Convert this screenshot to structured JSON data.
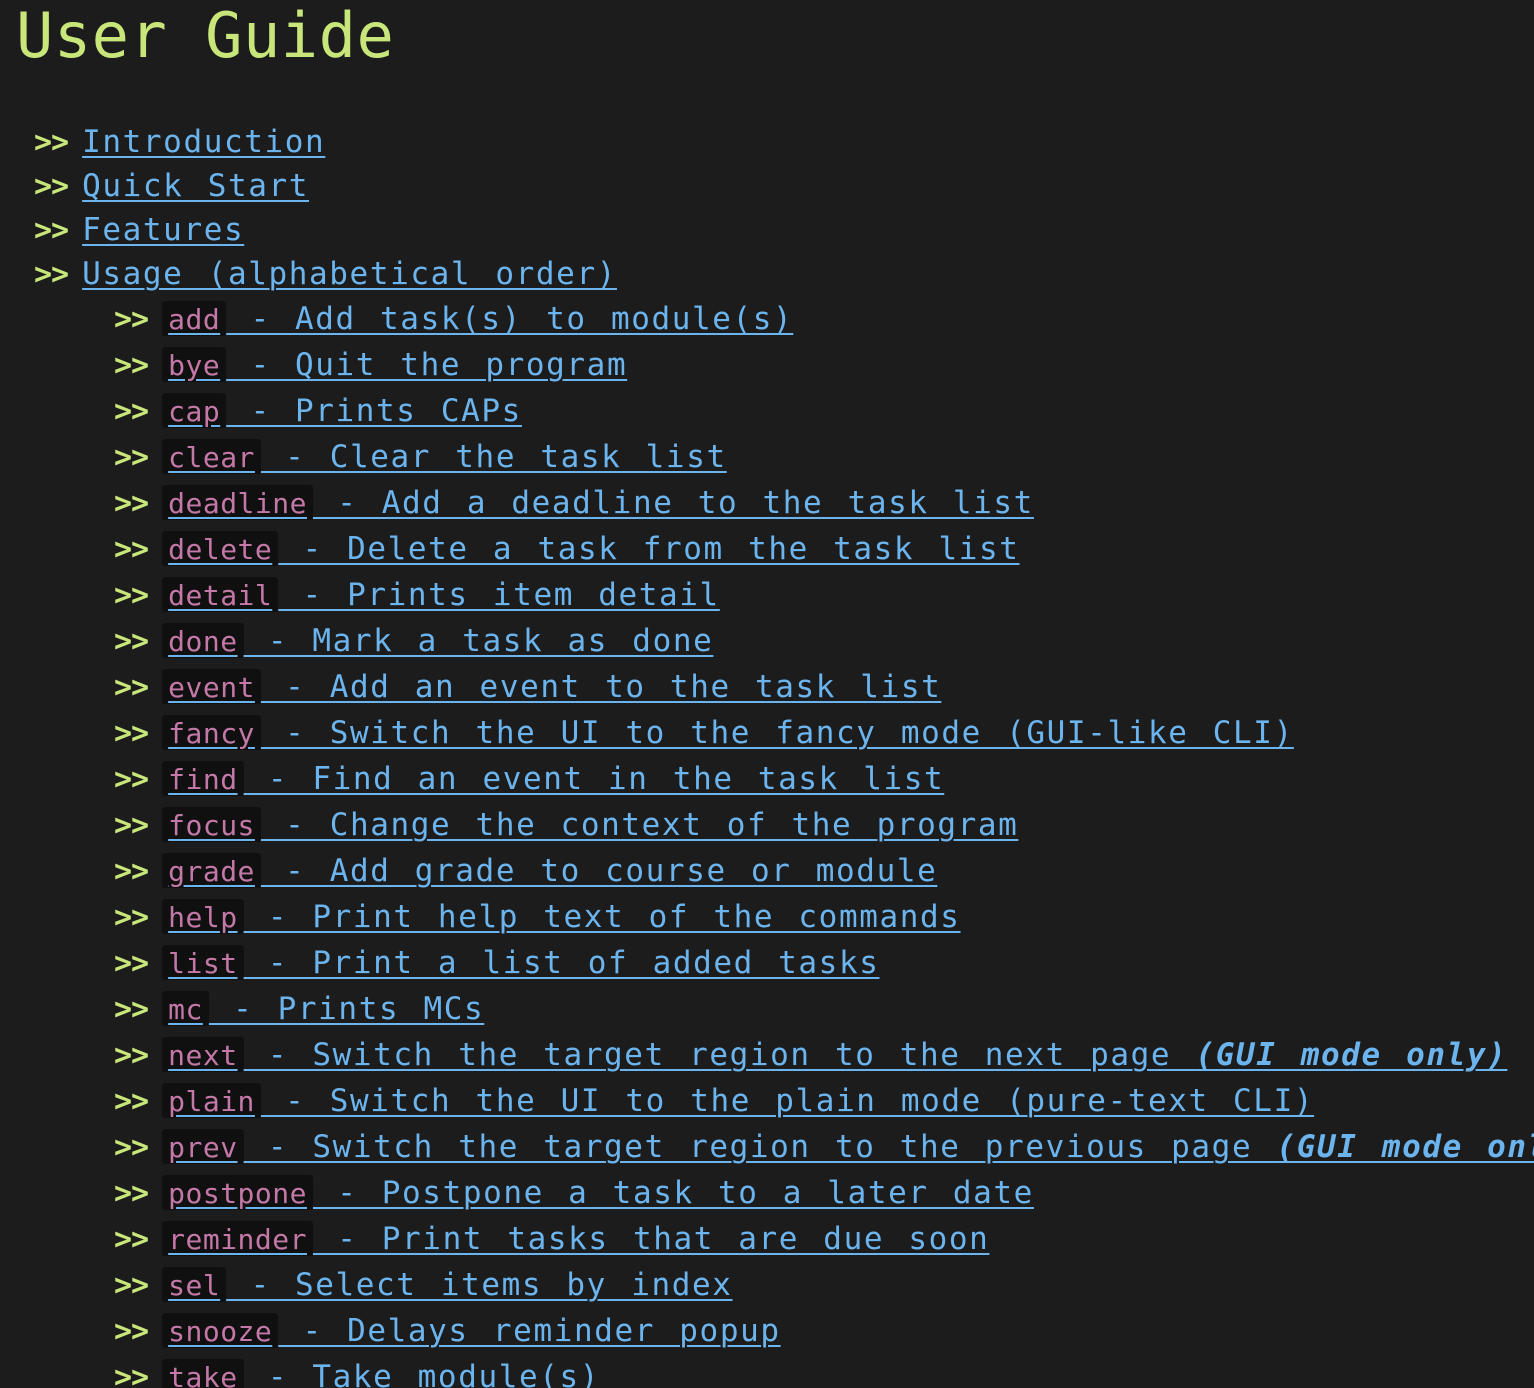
{
  "title": "User Guide",
  "toc": {
    "marker": ">>",
    "top_items": [
      {
        "label": "Introduction"
      },
      {
        "label": "Quick Start"
      },
      {
        "label": "Features"
      },
      {
        "label": "Usage (alphabetical order)"
      }
    ],
    "commands": [
      {
        "cmd": "add",
        "desc": " - Add task(s) to module(s)"
      },
      {
        "cmd": "bye",
        "desc": " - Quit the program"
      },
      {
        "cmd": "cap",
        "desc": " - Prints CAPs"
      },
      {
        "cmd": "clear",
        "desc": " - Clear the task list"
      },
      {
        "cmd": "deadline",
        "desc": " - Add a deadline to the task list"
      },
      {
        "cmd": "delete",
        "desc": " - Delete a task from the task list"
      },
      {
        "cmd": "detail",
        "desc": " - Prints item detail"
      },
      {
        "cmd": "done",
        "desc": " - Mark a task as done"
      },
      {
        "cmd": "event",
        "desc": " - Add an event to the task list"
      },
      {
        "cmd": "fancy",
        "desc": " - Switch the UI to the fancy mode (GUI-like CLI)"
      },
      {
        "cmd": "find",
        "desc": " - Find an event in the task list"
      },
      {
        "cmd": "focus",
        "desc": " - Change the context of the program"
      },
      {
        "cmd": "grade",
        "desc": " - Add grade to course or module"
      },
      {
        "cmd": "help",
        "desc": " - Print help text of the commands"
      },
      {
        "cmd": "list",
        "desc": " - Print a list of added tasks"
      },
      {
        "cmd": "mc",
        "desc": " - Prints MCs"
      },
      {
        "cmd": "next",
        "desc": " - Switch the target region to the next page ",
        "emph": "(GUI mode only)"
      },
      {
        "cmd": "plain",
        "desc": " - Switch the UI to the plain mode (pure-text CLI)"
      },
      {
        "cmd": "prev",
        "desc": " - Switch the target region to the previous page ",
        "emph": "(GUI mode only)"
      },
      {
        "cmd": "postpone",
        "desc": " - Postpone a task to a later date"
      },
      {
        "cmd": "reminder",
        "desc": " - Print tasks that are due soon"
      },
      {
        "cmd": "sel",
        "desc": " - Select items by index"
      },
      {
        "cmd": "snooze",
        "desc": " - Delays reminder popup"
      },
      {
        "cmd": "take",
        "desc": " - Take module(s)"
      }
    ]
  },
  "colors": {
    "background": "#1c1c1c",
    "title": "#c8e67a",
    "link": "#6cb4ee",
    "code_text": "#c478a8",
    "code_bg": "#101010"
  }
}
